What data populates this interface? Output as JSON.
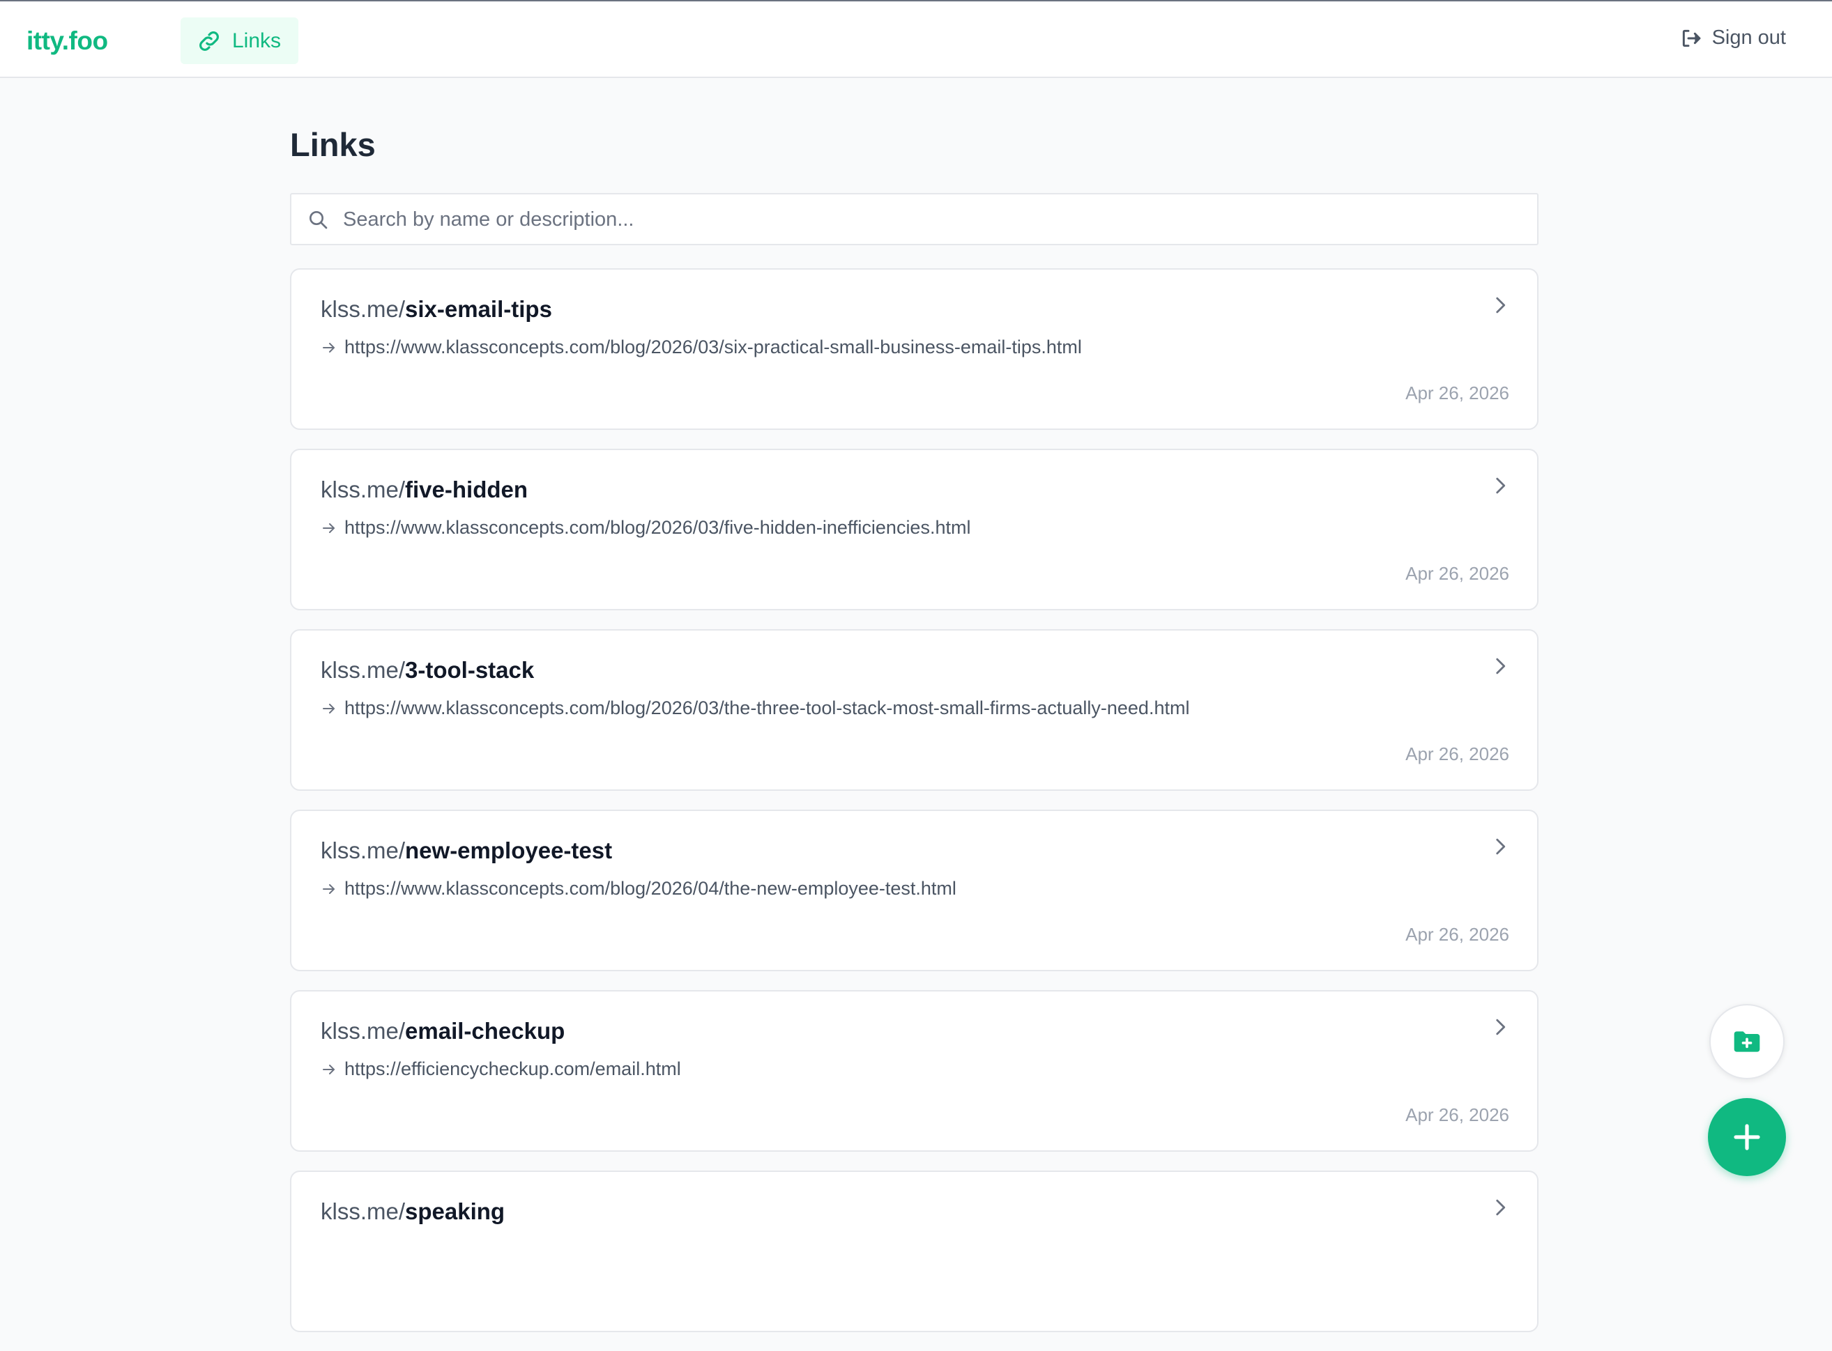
{
  "app": {
    "brand": "itty.foo"
  },
  "nav": {
    "links_label": "Links",
    "signout_label": "Sign out"
  },
  "page": {
    "title": "Links"
  },
  "search": {
    "placeholder": "Search by name or description...",
    "value": ""
  },
  "colors": {
    "accent": "#10b981",
    "accent_bg": "#ecfdf5"
  },
  "links": [
    {
      "domain": "klss.me/",
      "slug": "six-email-tips",
      "destination": "https://www.klassconcepts.com/blog/2026/03/six-practical-small-business-email-tips.html",
      "date": "Apr 26, 2026"
    },
    {
      "domain": "klss.me/",
      "slug": "five-hidden",
      "destination": "https://www.klassconcepts.com/blog/2026/03/five-hidden-inefficiencies.html",
      "date": "Apr 26, 2026"
    },
    {
      "domain": "klss.me/",
      "slug": "3-tool-stack",
      "destination": "https://www.klassconcepts.com/blog/2026/03/the-three-tool-stack-most-small-firms-actually-need.html",
      "date": "Apr 26, 2026"
    },
    {
      "domain": "klss.me/",
      "slug": "new-employee-test",
      "destination": "https://www.klassconcepts.com/blog/2026/04/the-new-employee-test.html",
      "date": "Apr 26, 2026"
    },
    {
      "domain": "klss.me/",
      "slug": "email-checkup",
      "destination": "https://efficiencycheckup.com/email.html",
      "date": "Apr 26, 2026"
    },
    {
      "domain": "klss.me/",
      "slug": "speaking",
      "destination": "",
      "date": ""
    }
  ]
}
